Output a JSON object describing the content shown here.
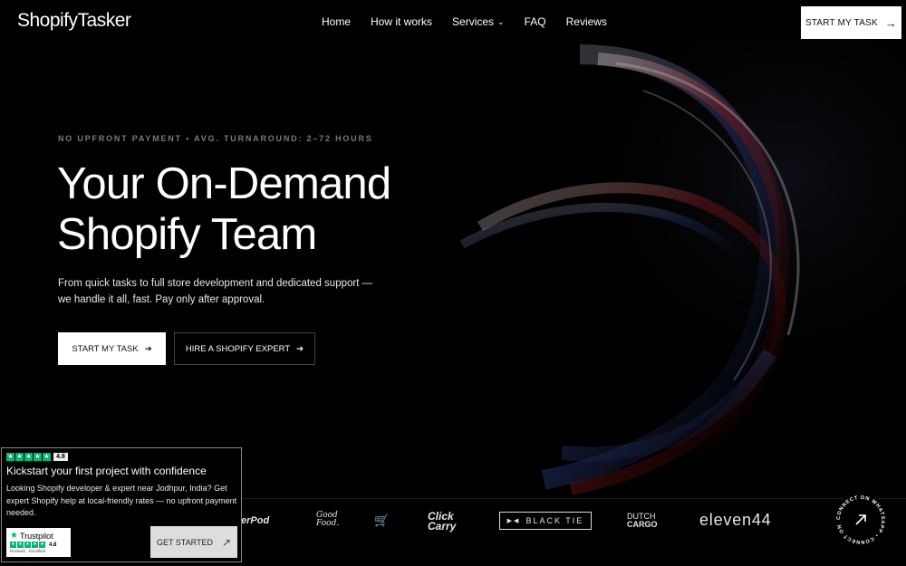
{
  "header": {
    "logo": "ShopifyTasker",
    "nav": [
      {
        "label": "Home"
      },
      {
        "label": "How it works"
      },
      {
        "label": "Services"
      },
      {
        "label": "FAQ"
      },
      {
        "label": "Reviews"
      }
    ],
    "cta_label": "START MY TASK",
    "cta_icon": "arrow-right-icon"
  },
  "hero": {
    "eyebrow": "NO UPFRONT PAYMENT • AVG. TURNAROUND: 2–72 HOURS",
    "headline_line1": "Your On-Demand",
    "headline_line2": "Shopify Team",
    "subtext": "From quick tasks to full store development and dedicated support — we handle it all, fast. Pay only after approval.",
    "primary_cta": "START MY TASK",
    "secondary_cta": "HIRE A SHOPIFY EXPERT",
    "arrow": "➔"
  },
  "brands": {
    "pod": "erPod",
    "good_food_1": "Good",
    "good_food_2": "Food.",
    "click_1": "Click",
    "click_2": "Carry",
    "black_tie": "BLACK TIE",
    "dutch": "DUTCH",
    "cargo": "CARGO",
    "eleven": "eleven44"
  },
  "whatsapp_badge": {
    "ring_text": "CONNECT ON WHATSAPP • CONNECT ON WHATSAPP •",
    "icon": "arrow-up-right-icon"
  },
  "popup": {
    "rating": "4.8",
    "title": "Kickstart your first project with confidence",
    "body": "Looking Shopify developer & expert near Jodhpur, India? Get expert Shopify help at local-friendly rates — no upfront payment needed.",
    "trustpilot_label": "Trustpilot",
    "trustpilot_score": "4.8",
    "trustpilot_sub": "Reviews · Excellent",
    "cta_label": "GET STARTED",
    "cta_icon": "arrow-up-right-icon"
  },
  "colors": {
    "background": "#000000",
    "trustpilot_green": "#00b67a",
    "accent_red": "#8a1a1a",
    "accent_blue": "#2a3a78"
  }
}
